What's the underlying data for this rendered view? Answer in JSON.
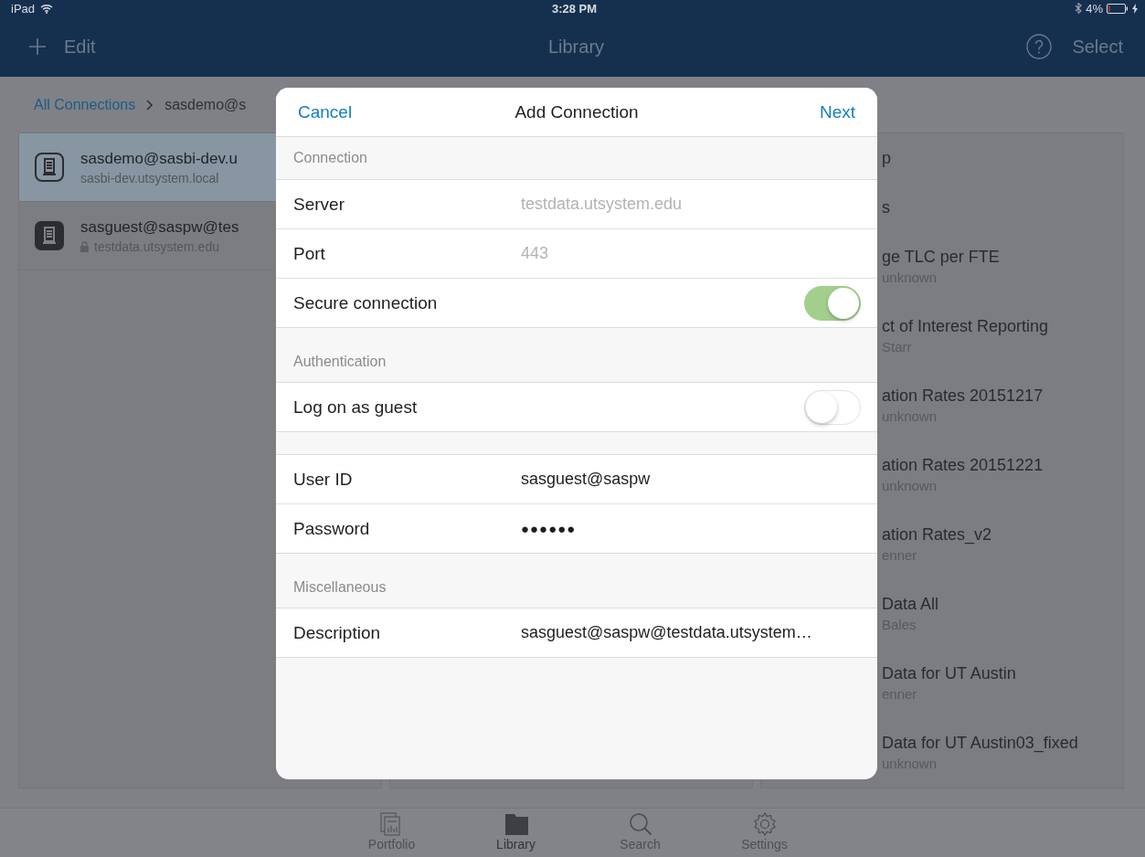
{
  "status_bar": {
    "carrier": "iPad",
    "time": "3:28 PM",
    "battery": "4%",
    "charging": true
  },
  "nav_bar": {
    "left_button": "Edit",
    "title": "Library",
    "right_button": "Select"
  },
  "breadcrumb": [
    {
      "label": "All Connections",
      "kind": "link"
    },
    {
      "label": "sasdemo@s",
      "kind": "current"
    }
  ],
  "connections": [
    {
      "name": "sasdemo@sasbi-dev.u",
      "host": "sasbi-dev.utsystem.local",
      "selected": true,
      "locked": false
    },
    {
      "name": "sasguest@saspw@tes",
      "host": "testdata.utsystem.edu",
      "selected": false,
      "locked": true
    }
  ],
  "reports": [
    {
      "title": "p"
    },
    {
      "title": "s"
    },
    {
      "title": "ge TLC per FTE",
      "subtitle": "unknown"
    },
    {
      "title": "ct of Interest Reporting",
      "subtitle": "Starr"
    },
    {
      "title": "ation Rates 20151217",
      "subtitle": "unknown"
    },
    {
      "title": "ation Rates 20151221",
      "subtitle": "unknown"
    },
    {
      "title": "ation Rates_v2",
      "subtitle": "enner"
    },
    {
      "title": "Data All",
      "subtitle": "Bales"
    },
    {
      "title": "Data for UT Austin",
      "subtitle": "enner"
    },
    {
      "title": "Data for UT Austin03_fixed",
      "subtitle": "unknown"
    }
  ],
  "modal": {
    "cancel": "Cancel",
    "title": "Add Connection",
    "next": "Next",
    "sections": [
      {
        "header": "Connection",
        "rows": [
          {
            "kind": "text",
            "label": "Server",
            "placeholder": "testdata.utsystem.edu"
          },
          {
            "kind": "text",
            "label": "Port",
            "placeholder": "443"
          },
          {
            "kind": "toggle",
            "label": "Secure connection",
            "on": true
          }
        ]
      },
      {
        "header": "Authentication",
        "rows": [
          {
            "kind": "toggle",
            "label": "Log on as guest",
            "on": false
          }
        ]
      },
      {
        "rows": [
          {
            "kind": "text",
            "label": "User ID",
            "value": "sasguest@saspw"
          },
          {
            "kind": "password",
            "label": "Password",
            "value": "●●●●●●"
          }
        ]
      },
      {
        "header": "Miscellaneous",
        "rows": [
          {
            "kind": "text",
            "label": "Description",
            "value": "sasguest@saspw@testdata.utsystem…"
          }
        ]
      }
    ]
  },
  "tab_bar": [
    {
      "label": "Portfolio",
      "selected": false
    },
    {
      "label": "Library",
      "selected": true
    },
    {
      "label": "Search",
      "selected": false
    },
    {
      "label": "Settings",
      "selected": false
    }
  ]
}
